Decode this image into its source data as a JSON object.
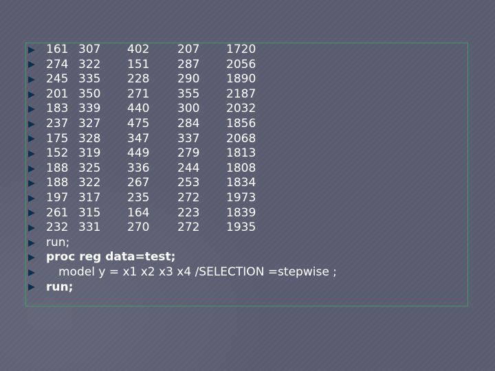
{
  "data_rows": [
    [
      "161",
      "307",
      "402",
      "207",
      "1720"
    ],
    [
      "274",
      "322",
      "151",
      "287",
      "2056"
    ],
    [
      "245",
      "335",
      "228",
      "290",
      "1890"
    ],
    [
      "201",
      "350",
      "271",
      "355",
      "2187"
    ],
    [
      "183",
      "339",
      "440",
      "300",
      "2032"
    ],
    [
      "237",
      "327",
      "475",
      "284",
      "1856"
    ],
    [
      "175",
      "328",
      "347",
      "337",
      "2068"
    ],
    [
      "152",
      "319",
      "449",
      "279",
      "1813"
    ],
    [
      "188",
      "325",
      "336",
      "244",
      "1808"
    ],
    [
      "188",
      "322",
      "267",
      "253",
      "1834"
    ],
    [
      "197",
      "317",
      "235",
      "272",
      "1973"
    ],
    [
      "261",
      "315",
      "164",
      "223",
      "1839"
    ],
    [
      "232",
      "331",
      "270",
      "272",
      "1935"
    ]
  ],
  "code_lines": [
    "run;",
    "proc reg data=test;",
    "model y = x1 x2 x3 x4 /SELECTION =stepwise ;",
    "run;"
  ],
  "colors": {
    "bullet": "#0d2f4f",
    "frame_border": "#3f9a68",
    "text": "#ffffff",
    "background": "#5a5d70"
  },
  "icons": {
    "bullet": "triangle-right-bullet-icon"
  }
}
